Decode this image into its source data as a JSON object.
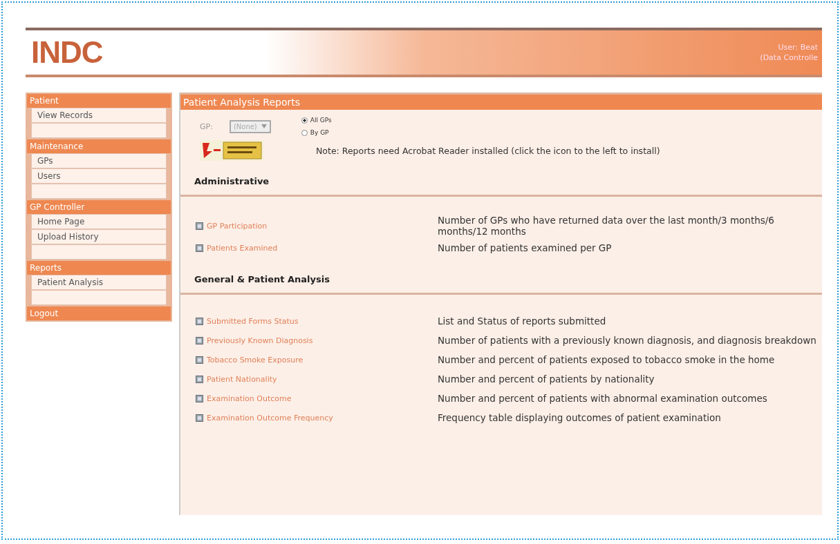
{
  "header": {
    "logo": "INDC",
    "user": "User: Beat",
    "role": "(Data Controlle"
  },
  "sidebar": [
    {
      "title": "Patient",
      "items": [
        "View Records"
      ]
    },
    {
      "title": "Maintenance",
      "items": [
        "GPs",
        "Users"
      ]
    },
    {
      "title": "GP Controller",
      "items": [
        "Home Page",
        "Upload History"
      ]
    },
    {
      "title": "Reports",
      "items": [
        "Patient Analysis"
      ]
    },
    {
      "title": "Logout"
    }
  ],
  "panel": {
    "title": "Patient Analysis Reports",
    "gp_label": "GP:",
    "gp_select": {
      "value": "(None)",
      "disabled": true
    },
    "scope": [
      {
        "label": "All GPs",
        "selected": true
      },
      {
        "label": "By GP",
        "selected": false
      }
    ],
    "note": "Note: Reports need Acrobat Reader installed (click the icon to the left to install)",
    "sections": [
      {
        "heading": "Administrative",
        "reports": [
          {
            "name": "GP Participation",
            "description": "Number of GPs who have returned data over the last month/3 months/6 months/12 months"
          },
          {
            "name": "Patients Examined",
            "description": "Number of patients examined per GP"
          }
        ]
      },
      {
        "heading": "General & Patient Analysis",
        "reports": [
          {
            "name": "Submitted Forms Status",
            "description": "List and Status of reports submitted"
          },
          {
            "name": "Previously Known Diagnosis",
            "description": "Number of patients with a previously known diagnosis, and diagnosis breakdown"
          },
          {
            "name": "Tobacco Smoke Exposure",
            "description": "Number and percent of patients exposed to tobacco smoke in the home"
          },
          {
            "name": "Patient Nationality",
            "description": "Number and percent of patients by nationality"
          },
          {
            "name": "Examination Outcome",
            "description": "Number and percent of patients with abnormal examination outcomes"
          },
          {
            "name": "Examination Outcome Frequency",
            "description": "Frequency table displaying outcomes of patient examination"
          }
        ]
      }
    ]
  }
}
